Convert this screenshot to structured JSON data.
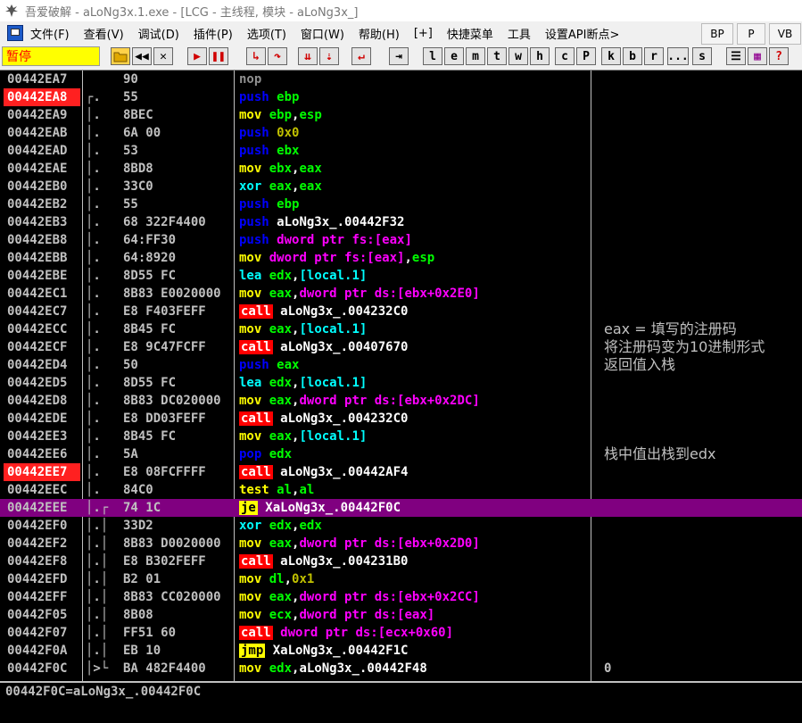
{
  "window": {
    "title": "吾爱破解 - aLoNg3x.1.exe - [LCG - 主线程, 模块 - aLoNg3x_]"
  },
  "menu": {
    "items": [
      "文件(F)",
      "查看(V)",
      "调试(D)",
      "插件(P)",
      "选项(T)",
      "窗口(W)",
      "帮助(H)",
      "[+]",
      "快捷菜单",
      "工具",
      "设置API断点>"
    ],
    "right_buttons": [
      "BP",
      "P",
      "VB"
    ]
  },
  "toolbar": {
    "status_label": "暂停",
    "letters": [
      "l",
      "e",
      "m",
      "t",
      "w",
      "h",
      "c",
      "P",
      "k",
      "b",
      "r",
      "...",
      "s"
    ]
  },
  "disasm": {
    "rows": [
      {
        "addr": "00442EA7",
        "bp": false,
        "sel": false,
        "marker": "",
        "bytes": "90",
        "mn": "nop",
        "ops": "",
        "comment": ""
      },
      {
        "addr": "00442EA8",
        "bp": true,
        "sel": false,
        "marker": "┌.",
        "bytes": "55",
        "mn": "push",
        "ops": "ebp",
        "comment": ""
      },
      {
        "addr": "00442EA9",
        "bp": false,
        "sel": false,
        "marker": "│.",
        "bytes": "8BEC",
        "mn": "mov",
        "ops": "ebp,esp",
        "comment": ""
      },
      {
        "addr": "00442EAB",
        "bp": false,
        "sel": false,
        "marker": "│.",
        "bytes": "6A 00",
        "mn": "push",
        "ops": "0x0",
        "comment": ""
      },
      {
        "addr": "00442EAD",
        "bp": false,
        "sel": false,
        "marker": "│.",
        "bytes": "53",
        "mn": "push",
        "ops": "ebx",
        "comment": ""
      },
      {
        "addr": "00442EAE",
        "bp": false,
        "sel": false,
        "marker": "│.",
        "bytes": "8BD8",
        "mn": "mov",
        "ops": "ebx,eax",
        "comment": ""
      },
      {
        "addr": "00442EB0",
        "bp": false,
        "sel": false,
        "marker": "│.",
        "bytes": "33C0",
        "mn": "xor",
        "ops": "eax,eax",
        "comment": ""
      },
      {
        "addr": "00442EB2",
        "bp": false,
        "sel": false,
        "marker": "│.",
        "bytes": "55",
        "mn": "push",
        "ops": "ebp",
        "comment": ""
      },
      {
        "addr": "00442EB3",
        "bp": false,
        "sel": false,
        "marker": "│.",
        "bytes": "68 322F4400",
        "mn": "push",
        "ops": "aLoNg3x_.00442F32",
        "comment": ""
      },
      {
        "addr": "00442EB8",
        "bp": false,
        "sel": false,
        "marker": "│.",
        "bytes": "64:FF30",
        "mn": "push",
        "ops": "dword ptr fs:[eax]",
        "comment": ""
      },
      {
        "addr": "00442EBB",
        "bp": false,
        "sel": false,
        "marker": "│.",
        "bytes": "64:8920",
        "mn": "mov",
        "ops": "dword ptr fs:[eax],esp",
        "comment": ""
      },
      {
        "addr": "00442EBE",
        "bp": false,
        "sel": false,
        "marker": "│.",
        "bytes": "8D55 FC",
        "mn": "lea",
        "ops": "edx,[local.1]",
        "comment": ""
      },
      {
        "addr": "00442EC1",
        "bp": false,
        "sel": false,
        "marker": "│.",
        "bytes": "8B83 E0020000",
        "mn": "mov",
        "ops": "eax,dword ptr ds:[ebx+0x2E0]",
        "comment": ""
      },
      {
        "addr": "00442EC7",
        "bp": false,
        "sel": false,
        "marker": "│.",
        "bytes": "E8 F403FEFF",
        "mn": "call",
        "ops": "aLoNg3x_.004232C0",
        "comment": ""
      },
      {
        "addr": "00442ECC",
        "bp": false,
        "sel": false,
        "marker": "│.",
        "bytes": "8B45 FC",
        "mn": "mov",
        "ops": "eax,[local.1]",
        "comment": "eax = 填写的注册码"
      },
      {
        "addr": "00442ECF",
        "bp": false,
        "sel": false,
        "marker": "│.",
        "bytes": "E8 9C47FCFF",
        "mn": "call",
        "ops": "aLoNg3x_.00407670",
        "comment": "将注册码变为10进制形式"
      },
      {
        "addr": "00442ED4",
        "bp": false,
        "sel": false,
        "marker": "│.",
        "bytes": "50",
        "mn": "push",
        "ops": "eax",
        "comment": "返回值入栈"
      },
      {
        "addr": "00442ED5",
        "bp": false,
        "sel": false,
        "marker": "│.",
        "bytes": "8D55 FC",
        "mn": "lea",
        "ops": "edx,[local.1]",
        "comment": ""
      },
      {
        "addr": "00442ED8",
        "bp": false,
        "sel": false,
        "marker": "│.",
        "bytes": "8B83 DC020000",
        "mn": "mov",
        "ops": "eax,dword ptr ds:[ebx+0x2DC]",
        "comment": ""
      },
      {
        "addr": "00442EDE",
        "bp": false,
        "sel": false,
        "marker": "│.",
        "bytes": "E8 DD03FEFF",
        "mn": "call",
        "ops": "aLoNg3x_.004232C0",
        "comment": ""
      },
      {
        "addr": "00442EE3",
        "bp": false,
        "sel": false,
        "marker": "│.",
        "bytes": "8B45 FC",
        "mn": "mov",
        "ops": "eax,[local.1]",
        "comment": ""
      },
      {
        "addr": "00442EE6",
        "bp": false,
        "sel": false,
        "marker": "│.",
        "bytes": "5A",
        "mn": "pop",
        "ops": "edx",
        "comment": "栈中值出栈到edx"
      },
      {
        "addr": "00442EE7",
        "bp": true,
        "sel": false,
        "marker": "│.",
        "bytes": "E8 08FCFFFF",
        "mn": "call",
        "ops": "aLoNg3x_.00442AF4",
        "comment": ""
      },
      {
        "addr": "00442EEC",
        "bp": false,
        "sel": false,
        "marker": "│.",
        "bytes": "84C0",
        "mn": "test",
        "ops": "al,al",
        "comment": ""
      },
      {
        "addr": "00442EEE",
        "bp": false,
        "sel": true,
        "marker": "│.┌",
        "bytes": "74 1C",
        "mn": "je",
        "ops": "XaLoNg3x_.00442F0C",
        "comment": ""
      },
      {
        "addr": "00442EF0",
        "bp": false,
        "sel": false,
        "marker": "│.│",
        "bytes": "33D2",
        "mn": "xor",
        "ops": "edx,edx",
        "comment": ""
      },
      {
        "addr": "00442EF2",
        "bp": false,
        "sel": false,
        "marker": "│.│",
        "bytes": "8B83 D0020000",
        "mn": "mov",
        "ops": "eax,dword ptr ds:[ebx+0x2D0]",
        "comment": ""
      },
      {
        "addr": "00442EF8",
        "bp": false,
        "sel": false,
        "marker": "│.│",
        "bytes": "E8 B302FEFF",
        "mn": "call",
        "ops": "aLoNg3x_.004231B0",
        "comment": ""
      },
      {
        "addr": "00442EFD",
        "bp": false,
        "sel": false,
        "marker": "│.│",
        "bytes": "B2 01",
        "mn": "mov",
        "ops": "dl,0x1",
        "comment": ""
      },
      {
        "addr": "00442EFF",
        "bp": false,
        "sel": false,
        "marker": "│.│",
        "bytes": "8B83 CC020000",
        "mn": "mov",
        "ops": "eax,dword ptr ds:[ebx+0x2CC]",
        "comment": ""
      },
      {
        "addr": "00442F05",
        "bp": false,
        "sel": false,
        "marker": "│.│",
        "bytes": "8B08",
        "mn": "mov",
        "ops": "ecx,dword ptr ds:[eax]",
        "comment": ""
      },
      {
        "addr": "00442F07",
        "bp": false,
        "sel": false,
        "marker": "│.│",
        "bytes": "FF51 60",
        "mn": "call",
        "ops": "dword ptr ds:[ecx+0x60]",
        "comment": ""
      },
      {
        "addr": "00442F0A",
        "bp": false,
        "sel": false,
        "marker": "│.│",
        "bytes": "EB 10",
        "mn": "jmp",
        "ops": "XaLoNg3x_.00442F1C",
        "comment": ""
      },
      {
        "addr": "00442F0C",
        "bp": false,
        "sel": false,
        "marker": "│>└",
        "bytes": "BA 482F4400",
        "mn": "mov",
        "ops": "edx,aLoNg3x_.00442F48",
        "comment": "0"
      }
    ]
  },
  "status_line": {
    "text": "00442F0C=aLoNg3x_.00442F0C"
  },
  "colors": {
    "breakpoint": "#ff2020",
    "selected_row": "#800080",
    "call_bg": "#ff0000",
    "jump_bg": "#ffff00"
  }
}
